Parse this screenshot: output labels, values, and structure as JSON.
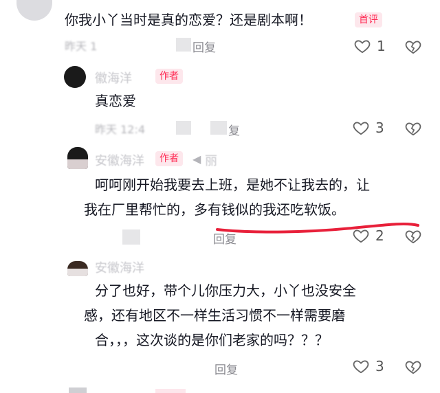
{
  "comments": [
    {
      "text": "你我小丫当时是真的恋爱？还是剧本啊！",
      "badge": "首评",
      "meta": "昨天 1",
      "reply": "回复",
      "likes": "1"
    },
    {
      "name": "徽海洋",
      "badge": "作者",
      "text": "真恋爱",
      "meta": "昨天 12:4",
      "reply": "复",
      "likes": "3"
    },
    {
      "name": "安徽海洋",
      "badge": "作者",
      "reply_to": "丽",
      "text_lines": [
        "呵呵刚开始我要去上班，是她不让我去的，让",
        "我在厂里帮忙的，多有钱似的我还吃软饭。"
      ],
      "meta": "",
      "reply": "回复",
      "likes": "2"
    },
    {
      "name": "安徽海洋",
      "text_lines": [
        "分了也好，带个儿你压力大，小丫也没安全",
        "感，还有地区不一样生活习惯不一样需要磨",
        "合，，，这次谈的是你们老家的吗？？？"
      ],
      "reply": "回复",
      "likes": "3"
    }
  ],
  "colors": {
    "accent": "#fe2c55",
    "underline": "#e8203a"
  },
  "icons": {
    "like": "heart-outline-icon",
    "dislike": "broken-heart-icon"
  }
}
